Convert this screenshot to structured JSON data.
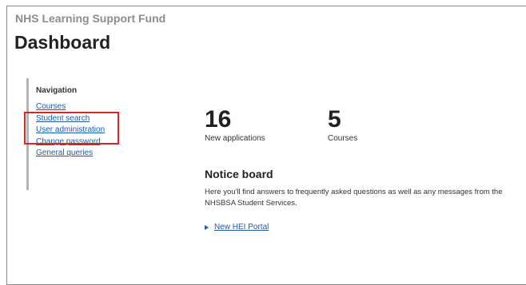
{
  "header": {
    "app_title": "NHS Learning Support Fund",
    "page_title": "Dashboard"
  },
  "navigation": {
    "heading": "Navigation",
    "items": [
      {
        "label": "Courses"
      },
      {
        "label": "Student search"
      },
      {
        "label": "User administration"
      },
      {
        "label": "Change password"
      },
      {
        "label": "General queries"
      }
    ]
  },
  "stats": {
    "applications": {
      "value": "16",
      "label": "New applications"
    },
    "courses": {
      "value": "5",
      "label": "Courses"
    }
  },
  "notice_board": {
    "title": "Notice board",
    "text": "Here you'll find answers to frequently asked questions as well as any messages from the NHSBSA Student Services.",
    "link_label": "New HEI Portal"
  },
  "colors": {
    "link": "#1d5aa8",
    "highlight": "#d7262e",
    "nav_border": "#b3b3b3"
  }
}
